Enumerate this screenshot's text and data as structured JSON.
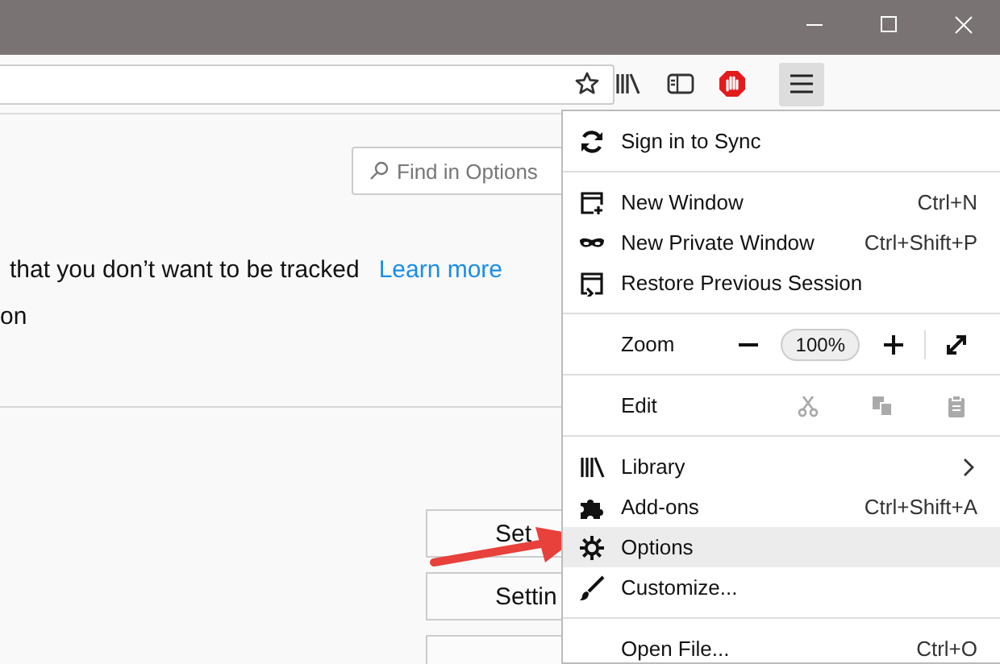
{
  "toolbar": {
    "menu_open": true
  },
  "content": {
    "search": {
      "placeholder": "Find in Options"
    },
    "tracking_text": "that you don’t want to be tracked",
    "learn_more": "Learn more",
    "line_2": "on",
    "buttons": [
      {
        "label": "Set"
      },
      {
        "label": "Settin"
      }
    ]
  },
  "menu": {
    "items": [
      {
        "kind": "item",
        "label": "Sign in to Sync",
        "selected": false
      },
      {
        "kind": "separator"
      },
      {
        "kind": "item",
        "label": "New Window",
        "shortcut": "Ctrl+N",
        "selected": false
      },
      {
        "kind": "item",
        "label": "New Private Window",
        "shortcut": "Ctrl+Shift+P",
        "selected": false
      },
      {
        "kind": "item",
        "label": "Restore Previous Session",
        "selected": false
      },
      {
        "kind": "separator"
      },
      {
        "kind": "zoom",
        "label": "Zoom",
        "value": "100%"
      },
      {
        "kind": "separator"
      },
      {
        "kind": "edit",
        "label": "Edit"
      },
      {
        "kind": "separator"
      },
      {
        "kind": "submenu",
        "label": "Library",
        "selected": false
      },
      {
        "kind": "item",
        "label": "Add-ons",
        "shortcut": "Ctrl+Shift+A",
        "selected": false
      },
      {
        "kind": "item",
        "label": "Options",
        "selected": true
      },
      {
        "kind": "item",
        "label": "Customize...",
        "selected": false
      },
      {
        "kind": "separator"
      },
      {
        "kind": "item",
        "label": "Open File...",
        "shortcut": "Ctrl+O",
        "selected": false
      }
    ]
  }
}
